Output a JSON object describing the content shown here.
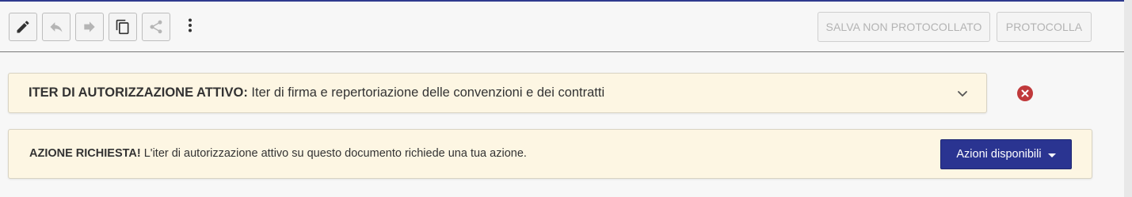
{
  "toolbar": {
    "tools": [
      {
        "name": "edit",
        "icon": "pencil-icon"
      },
      {
        "name": "undo",
        "icon": "reply-icon"
      },
      {
        "name": "forward",
        "icon": "arrow-right-icon"
      },
      {
        "name": "copy",
        "icon": "copy-icon"
      },
      {
        "name": "share",
        "icon": "share-icon"
      }
    ],
    "more_icon": "more-vertical-icon",
    "save_label": "SALVA NON PROTOCOLLATO",
    "protocol_label": "PROTOCOLLA"
  },
  "iter_panel": {
    "title_strong": "ITER DI AUTORIZZAZIONE ATTIVO:",
    "title_text": " Iter di firma e repertoriazione delle convenzioni e dei contratti",
    "expand_icon": "chevron-down-icon",
    "close_icon": "close-circle-icon"
  },
  "action_panel": {
    "strong": "AZIONE RICHIESTA!",
    "text": " L'iter di autorizzazione attivo su questo documento richiede una tua azione.",
    "button_label": "Azioni disponibili"
  },
  "colors": {
    "accent": "#2a3491",
    "panel_bg": "#fdf6e3",
    "danger": "#c0393b"
  }
}
